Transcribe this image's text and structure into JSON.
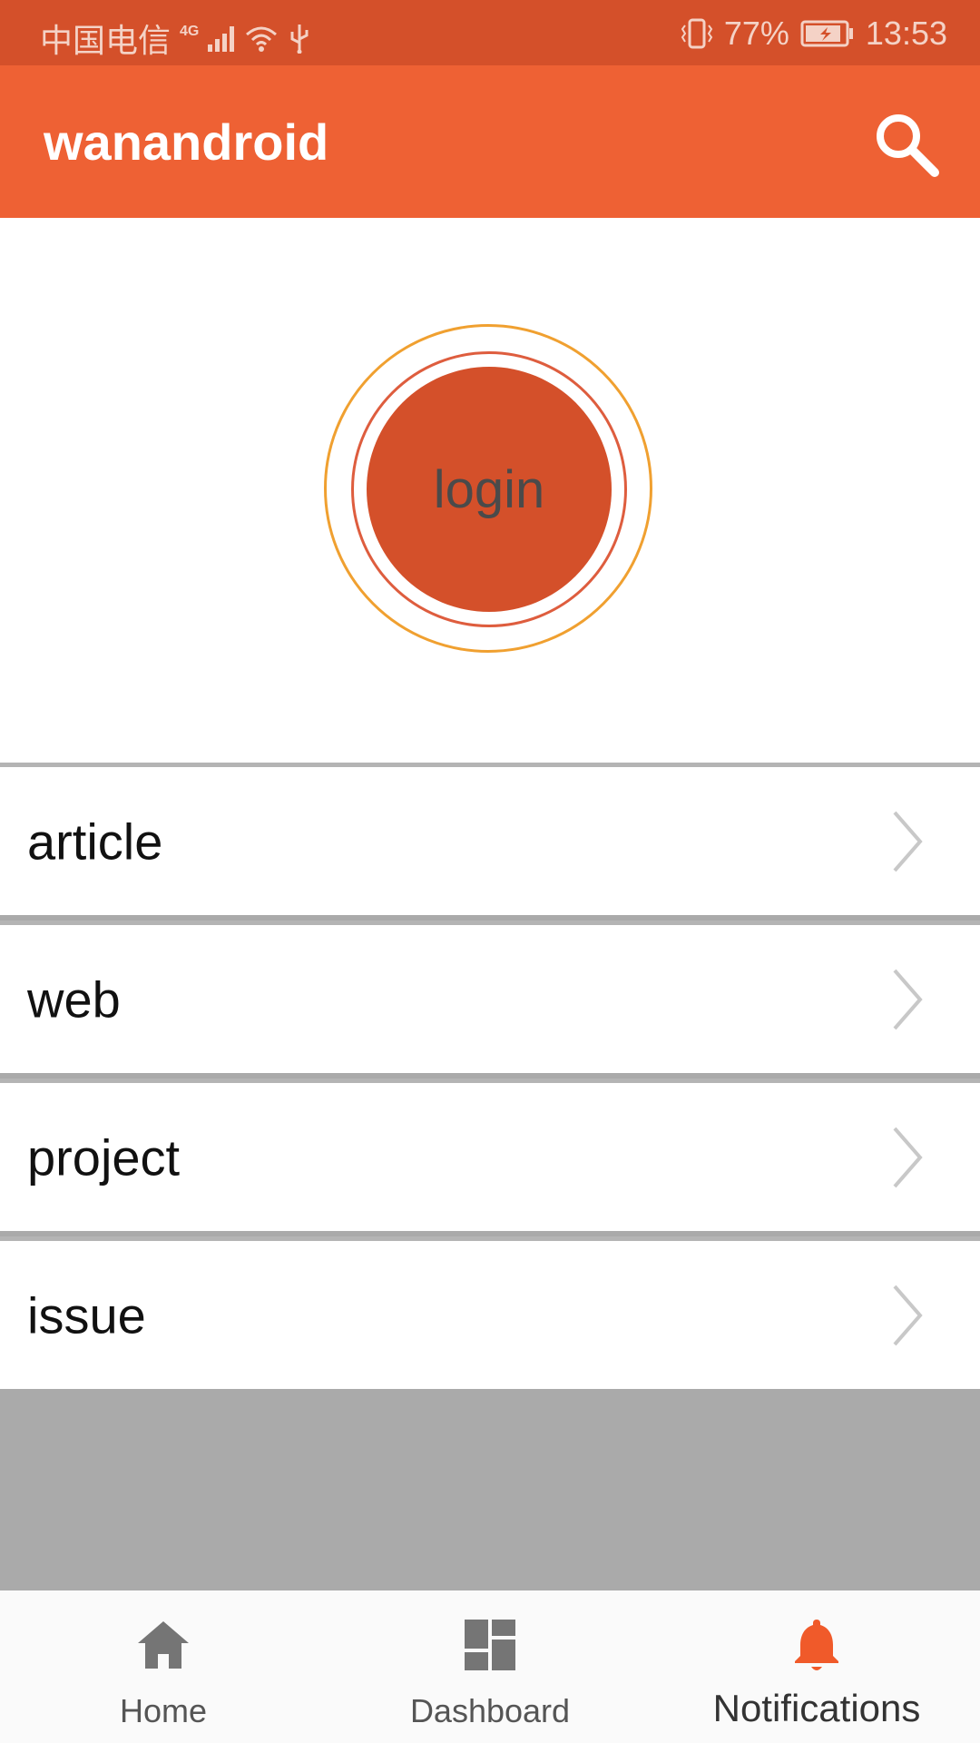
{
  "status_bar": {
    "carrier": "中国电信",
    "network": "4G",
    "battery": "77%",
    "time": "13:53"
  },
  "app_bar": {
    "title": "wanandroid",
    "search_icon": "search-icon"
  },
  "header": {
    "login_label": "login"
  },
  "menu": {
    "items": [
      {
        "label": "article"
      },
      {
        "label": "web"
      },
      {
        "label": "project"
      },
      {
        "label": "issue"
      }
    ]
  },
  "bottom_nav": {
    "items": [
      {
        "label": "Home",
        "icon": "home-icon"
      },
      {
        "label": "Dashboard",
        "icon": "dashboard-icon"
      },
      {
        "label": "Notifications",
        "icon": "bell-icon",
        "active": true
      }
    ]
  },
  "colors": {
    "status_bar": "#d4502a",
    "app_bar": "#ee6134",
    "accent": "#f05a2a",
    "ring_outer": "#f0a030",
    "ring_inner": "#de5d3e"
  }
}
